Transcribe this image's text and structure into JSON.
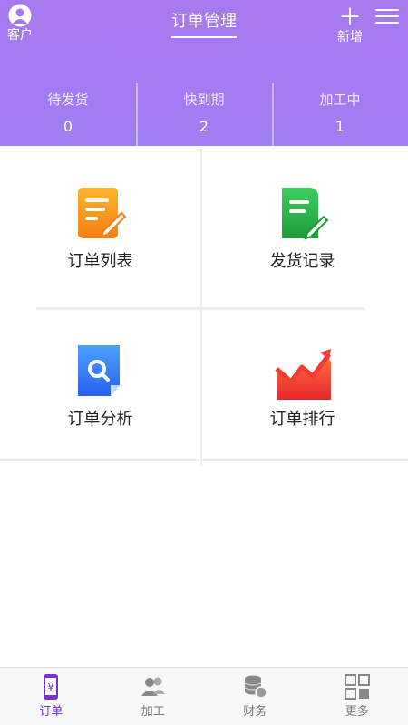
{
  "header": {
    "title": "订单管理",
    "left_label": "客户",
    "right_label": "新增",
    "accent": "#a37af2"
  },
  "stats": [
    {
      "label": "待发货",
      "value": "0"
    },
    {
      "label": "快到期",
      "value": "2"
    },
    {
      "label": "加工中",
      "value": "1"
    }
  ],
  "menu": [
    {
      "label": "订单列表",
      "icon": "order-list-icon",
      "color": "#f89a1c"
    },
    {
      "label": "发货记录",
      "icon": "shipping-record-icon",
      "color": "#2db34a"
    },
    {
      "label": "订单分析",
      "icon": "order-analysis-icon",
      "color": "#2f7ef5"
    },
    {
      "label": "订单排行",
      "icon": "order-ranking-icon",
      "color": "#f2413a"
    }
  ],
  "tabs": [
    {
      "label": "订单",
      "icon": "order-phone-icon",
      "active": true
    },
    {
      "label": "加工",
      "icon": "users-icon",
      "active": false
    },
    {
      "label": "财务",
      "icon": "coins-icon",
      "active": false
    },
    {
      "label": "更多",
      "icon": "grid-icon",
      "active": false
    }
  ],
  "colors": {
    "active_tab": "#7b2ed0",
    "inactive_tab": "#777777"
  }
}
